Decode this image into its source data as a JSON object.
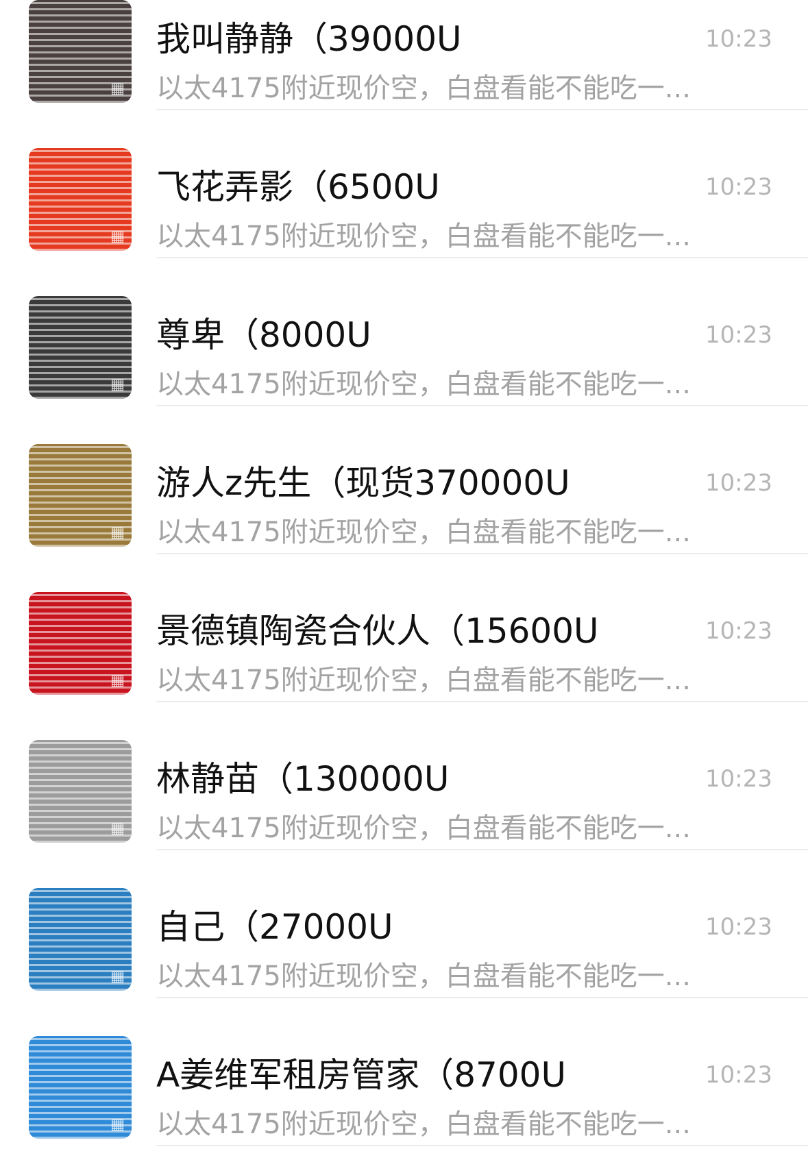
{
  "chats": [
    {
      "name": "我叫静静（39000U",
      "time": "10:23",
      "preview": "以太4175附近现价空，白盘看能不能吃一...",
      "avatar_color": "#4a4040",
      "avatar_icon": "photo-icon"
    },
    {
      "name": "飞花弄影（6500U",
      "time": "10:23",
      "preview": "以太4175附近现价空，白盘看能不能吃一...",
      "avatar_color": "#e53a1f",
      "avatar_icon": "photo-icon"
    },
    {
      "name": "尊卑（8000U",
      "time": "10:23",
      "preview": "以太4175附近现价空，白盘看能不能吃一...",
      "avatar_color": "#3a3a3a",
      "avatar_icon": "photo-icon"
    },
    {
      "name": "游人z先生（现货370000U",
      "time": "10:23",
      "preview": "以太4175附近现价空，白盘看能不能吃一...",
      "avatar_color": "#9a7a3a",
      "avatar_icon": "photo-icon"
    },
    {
      "name": "景德镇陶瓷合伙人（15600U",
      "time": "10:23",
      "preview": "以太4175附近现价空，白盘看能不能吃一...",
      "avatar_color": "#c8141e",
      "avatar_icon": "photo-icon"
    },
    {
      "name": "林静苗（130000U",
      "time": "10:23",
      "preview": "以太4175附近现价空，白盘看能不能吃一...",
      "avatar_color": "#9c9c9c",
      "avatar_icon": "photo-icon"
    },
    {
      "name": "自己（27000U",
      "time": "10:23",
      "preview": "以太4175附近现价空，白盘看能不能吃一...",
      "avatar_color": "#2b7fc0",
      "avatar_icon": "photo-icon"
    },
    {
      "name": "A姜维军租房管家（8700U",
      "time": "10:23",
      "preview": "以太4175附近现价空，白盘看能不能吃一...",
      "avatar_color": "#2f8ad8",
      "avatar_icon": "photo-icon"
    }
  ]
}
